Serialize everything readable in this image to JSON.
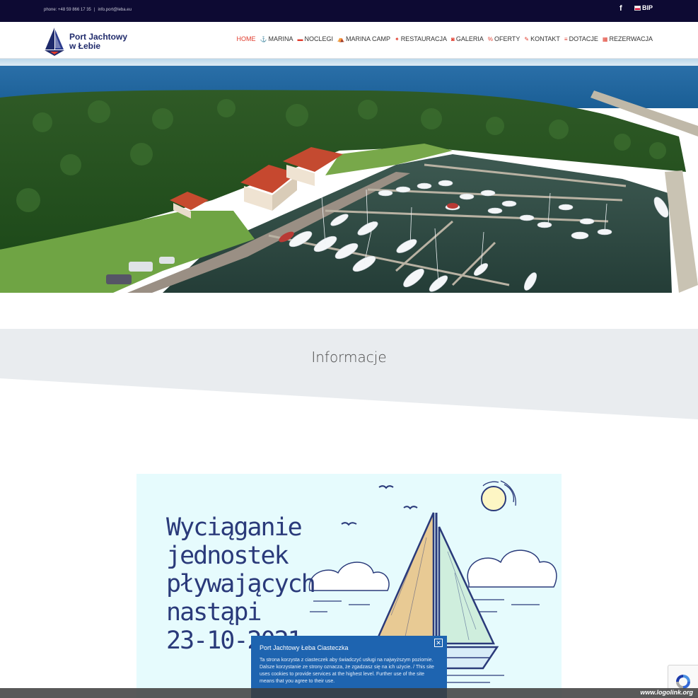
{
  "topbar": {
    "phone": "phone: +48 59 866 17 35",
    "separator": "|",
    "email": "info.port@leba.eu",
    "facebook_glyph": "f",
    "bip_label": "BIP",
    "icons": [
      "facebook-icon",
      "flag-pl-icon"
    ]
  },
  "header": {
    "logo_line1": "Port Jachtowy",
    "logo_line2": "w Łebie",
    "nav": [
      {
        "label": "HOME",
        "icon": "",
        "active": true
      },
      {
        "label": "MARINA",
        "icon": "⚓",
        "icon_name": "anchor-icon"
      },
      {
        "label": "NOCLEGI",
        "icon": "▬",
        "icon_name": "bed-icon"
      },
      {
        "label": "MARINA CAMP",
        "icon": "⛺",
        "icon_name": "tent-icon"
      },
      {
        "label": "RESTAURACJA",
        "icon": "✦",
        "icon_name": "cutlery-icon"
      },
      {
        "label": "GALERIA",
        "icon": "◙",
        "icon_name": "camera-icon"
      },
      {
        "label": "OFERTY",
        "icon": "%",
        "icon_name": "percent-icon"
      },
      {
        "label": "KONTAKT",
        "icon": "✎",
        "icon_name": "edit-icon"
      },
      {
        "label": "DOTACJE",
        "icon": "≡",
        "icon_name": "money-icon"
      },
      {
        "label": "REZERWACJA",
        "icon": "▦",
        "icon_name": "calendar-icon"
      }
    ],
    "accent_color": "#e03b2c"
  },
  "band": {
    "title": "Informacje",
    "color": "#e9ecef"
  },
  "poster": {
    "lines": [
      "Wyciąganie",
      "jednostek",
      "pływających",
      "nastąpi",
      "23-10-2021"
    ],
    "text_color": "#2a3a7a",
    "background": "#e6fbfd"
  },
  "cookie": {
    "title": "Port Jachtowy Łeba Ciasteczka",
    "body": "Ta strona korzysta z ciasteczek aby świadczyć usługi na najwyższym poziomie. Dalsze korzystanie ze strony oznacza, że zgadzasz się na ich użycie. / This site uses cookies to provide services at the highest level. Further use of the site means that you agree to their use.",
    "close_glyph": "✕",
    "color": "#1e64b0"
  },
  "watermark": "www.logolink.org"
}
